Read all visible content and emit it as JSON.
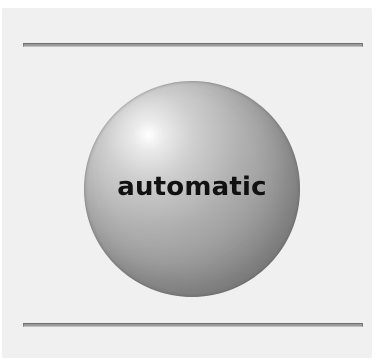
{
  "control": {
    "label": "automatic"
  }
}
